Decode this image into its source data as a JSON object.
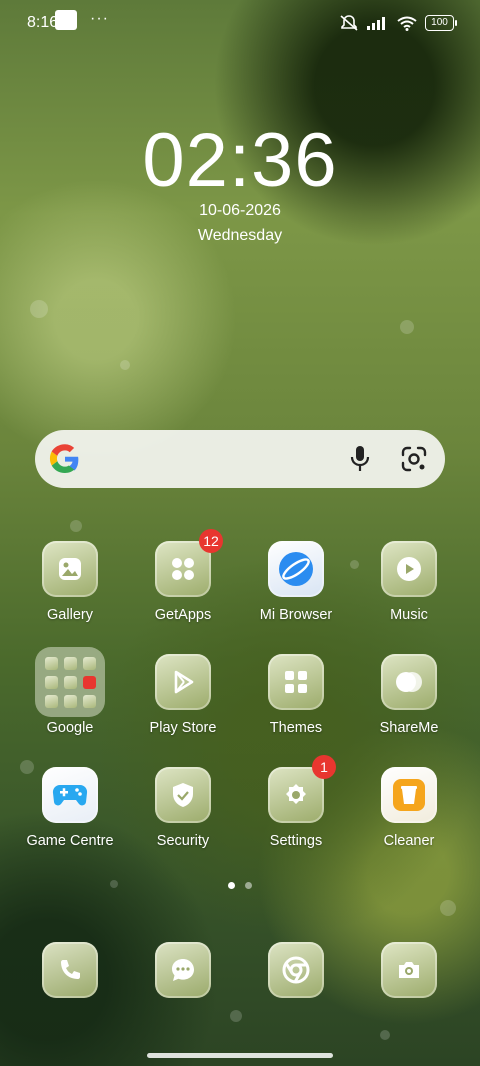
{
  "status_bar": {
    "time": "8:16",
    "more_indicator": "···",
    "battery": "100",
    "icons": [
      "square-notification-icon",
      "bell-muted-icon",
      "signal-icon",
      "wifi-icon",
      "battery-icon"
    ]
  },
  "lock_clock": {
    "time": "02:36",
    "date": "10-06-2026",
    "weekday": "Wednesday"
  },
  "search_bar": {
    "icons": [
      "google-g-icon",
      "microphone-icon",
      "google-lens-icon"
    ]
  },
  "apps": [
    {
      "label": "Gallery",
      "icon": "gallery-icon"
    },
    {
      "label": "GetApps",
      "icon": "getapps-icon",
      "badge": "12"
    },
    {
      "label": "Mi Browser",
      "icon": "mi-browser-icon"
    },
    {
      "label": "Music",
      "icon": "music-icon"
    },
    {
      "label": "Google",
      "icon": "folder-icon"
    },
    {
      "label": "Play Store",
      "icon": "play-store-icon"
    },
    {
      "label": "Themes",
      "icon": "themes-icon"
    },
    {
      "label": "ShareMe",
      "icon": "shareme-icon"
    },
    {
      "label": "Game Centre",
      "icon": "game-centre-icon"
    },
    {
      "label": "Security",
      "icon": "security-icon"
    },
    {
      "label": "Settings",
      "icon": "settings-icon",
      "badge": "1"
    },
    {
      "label": "Cleaner",
      "icon": "cleaner-icon"
    }
  ],
  "dock": [
    "phone-icon",
    "messages-icon",
    "chrome-icon",
    "camera-icon"
  ],
  "pager": {
    "pages": 2,
    "current": 1
  },
  "colors": {
    "badge": "#e8362f",
    "browser_blue": "#2b8cf0",
    "cleaner_orange": "#f5a51c",
    "game_blue": "#28a8f0"
  }
}
